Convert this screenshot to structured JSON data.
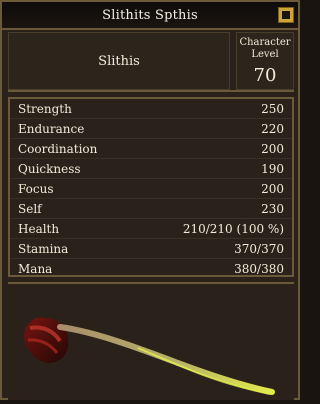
{
  "window": {
    "title": "Slithits Spthis"
  },
  "header": {
    "name": "Slithis",
    "level_label": "Character\nLevel",
    "level_value": "70"
  },
  "stats": [
    {
      "label": "Strength",
      "value": "250"
    },
    {
      "label": "Endurance",
      "value": "220"
    },
    {
      "label": "Coordination",
      "value": "200"
    },
    {
      "label": "Quickness",
      "value": "190"
    },
    {
      "label": "Focus",
      "value": "200"
    },
    {
      "label": "Self",
      "value": "230"
    },
    {
      "label": "Health",
      "value": "210/210 (100 %)"
    },
    {
      "label": "Stamina",
      "value": "370/370"
    },
    {
      "label": "Mana",
      "value": "380/380"
    }
  ],
  "icons": {
    "close": "close-icon",
    "item": "feather-quill-icon"
  }
}
